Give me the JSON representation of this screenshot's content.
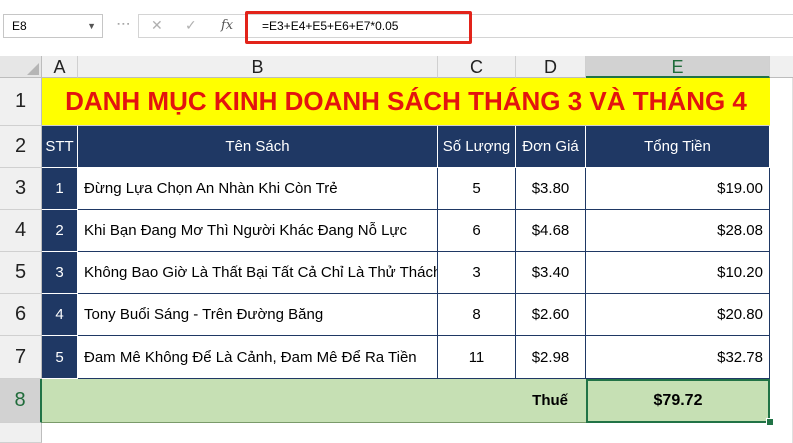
{
  "formula_bar": {
    "name_box": "E8",
    "cancel_symbol": "✕",
    "enter_symbol": "✓",
    "fx_label": "fx",
    "formula": "=E3+E4+E5+E6+E7*0.05"
  },
  "columns": [
    "A",
    "B",
    "C",
    "D",
    "E"
  ],
  "rows": [
    "1",
    "2",
    "3",
    "4",
    "5",
    "6",
    "7",
    "8"
  ],
  "sheet": {
    "title": "DANH MỤC KINH DOANH SÁCH THÁNG 3 VÀ THÁNG 4",
    "headers": {
      "stt": "STT",
      "ten_sach": "Tên Sách",
      "so_luong": "Số Lượng",
      "don_gia": "Đơn Giá",
      "tong_tien": "Tổng Tiền"
    },
    "items": [
      {
        "stt": "1",
        "ten_sach": "Đừng Lựa Chọn An Nhàn Khi Còn Trẻ",
        "so_luong": "5",
        "don_gia": "$3.80",
        "tong_tien": "$19.00"
      },
      {
        "stt": "2",
        "ten_sach": "Khi Bạn Đang Mơ Thì Người Khác Đang Nỗ Lực",
        "so_luong": "6",
        "don_gia": "$4.68",
        "tong_tien": "$28.08"
      },
      {
        "stt": "3",
        "ten_sach": "Không Bao Giờ Là Thất Bại Tất Cả Chỉ Là Thử Thách",
        "so_luong": "3",
        "don_gia": "$3.40",
        "tong_tien": "$10.20"
      },
      {
        "stt": "4",
        "ten_sach": "Tony Buổi Sáng - Trên Đường Băng",
        "so_luong": "8",
        "don_gia": "$2.60",
        "tong_tien": "$20.80"
      },
      {
        "stt": "5",
        "ten_sach": "Đam Mê Không Để Là Cảnh, Đam Mê Để Ra Tiền",
        "so_luong": "11",
        "don_gia": "$2.98",
        "tong_tien": "$32.78"
      }
    ],
    "tax_label": "Thuế",
    "tax_value": "$79.72"
  },
  "colors": {
    "title_bg": "#ffff00",
    "title_text": "#e3140f",
    "header_bg": "#1f3864",
    "total_row_bg": "#c6e0b4",
    "selection": "#217346",
    "highlight_box": "#e2231a"
  }
}
